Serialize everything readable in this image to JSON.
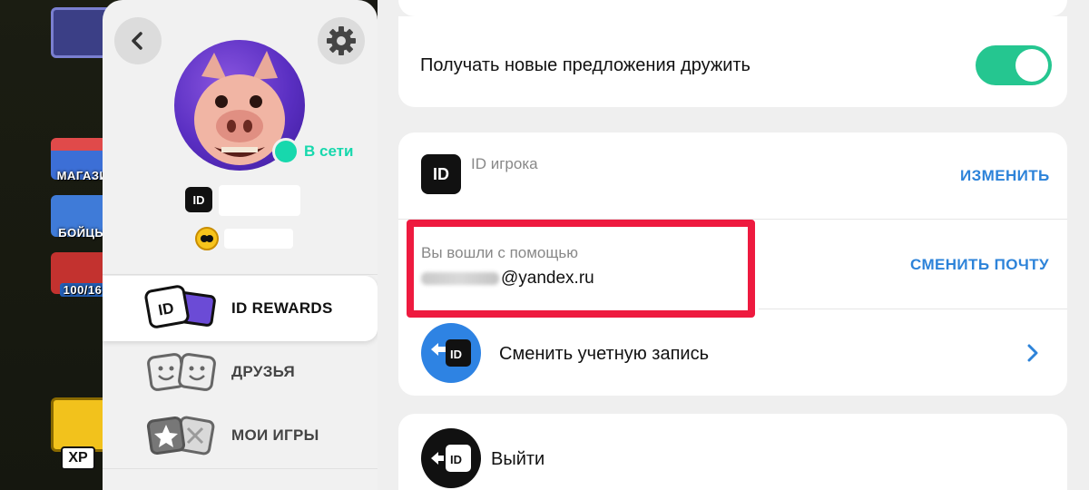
{
  "game_sidebar": {
    "shop_label": "МАГАЗИ",
    "brawlers_label": "БОЙЦЫ",
    "trophies_label": "100/16",
    "xp_label": "XP"
  },
  "profile": {
    "status": "В сети",
    "id_badge": "ID"
  },
  "menu": {
    "items": [
      {
        "label": "ID REWARDS",
        "active": true
      },
      {
        "label": "ДРУЗЬЯ",
        "active": false
      },
      {
        "label": "МОИ ИГРЫ",
        "active": false
      }
    ]
  },
  "settings": {
    "friend_requests_label": "Получать новые предложения дружить",
    "friend_requests_enabled": true,
    "player_id_label": "ID игрока",
    "player_id_icon_text": "ID",
    "change_button": "ИЗМЕНИТЬ",
    "logged_in_label": "Вы вошли с помощью",
    "email_domain": "@yandex.ru",
    "change_email_button": "СМЕНИТЬ ПОЧТУ",
    "switch_account_label": "Сменить учетную запись",
    "switch_icon_text": "ID",
    "logout_label": "Выйти",
    "logout_icon_text": "ID"
  },
  "colors": {
    "accent_link": "#2d83d9",
    "toggle_on": "#25c690",
    "online": "#17d8ad",
    "highlight": "#ee1a3f"
  }
}
